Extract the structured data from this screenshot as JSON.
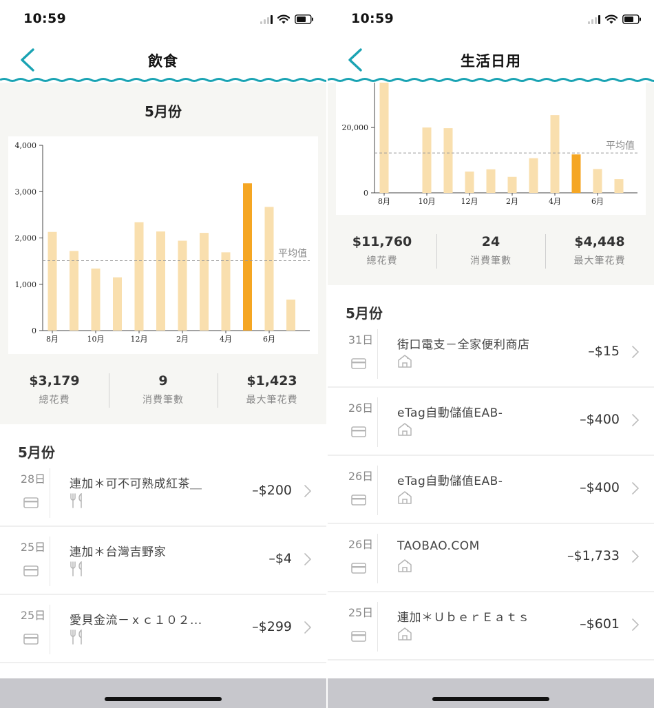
{
  "status_bar": {
    "time": "10:59"
  },
  "left": {
    "title": "飲食",
    "summary_heading": "5月份",
    "stats": [
      {
        "value": "$3,179",
        "label": "總花費"
      },
      {
        "value": "9",
        "label": "消費筆數"
      },
      {
        "value": "$1,423",
        "label": "最大筆花費"
      }
    ],
    "list_heading": "5月份",
    "transactions": [
      {
        "day": "28日",
        "name": "連加＊可不可熟成紅茶＿",
        "amount": "–$200",
        "category_icon": "utensils-icon"
      },
      {
        "day": "25日",
        "name": "連加＊台灣吉野家",
        "amount": "–$4",
        "category_icon": "utensils-icon"
      },
      {
        "day": "25日",
        "name": "愛貝金流－ｘｃ１０２...",
        "amount": "–$299",
        "category_icon": "utensils-icon"
      }
    ]
  },
  "right": {
    "title": "生活日用",
    "stats": [
      {
        "value": "$11,760",
        "label": "總花費"
      },
      {
        "value": "24",
        "label": "消費筆數"
      },
      {
        "value": "$4,448",
        "label": "最大筆花費"
      }
    ],
    "list_heading": "5月份",
    "transactions": [
      {
        "day": "31日",
        "name": "街口電支－全家便利商店",
        "amount": "–$15",
        "category_icon": "house-icon"
      },
      {
        "day": "26日",
        "name": "eTag自動儲值EAB-",
        "amount": "–$400",
        "category_icon": "house-icon"
      },
      {
        "day": "26日",
        "name": "eTag自動儲值EAB-",
        "amount": "–$400",
        "category_icon": "house-icon"
      },
      {
        "day": "26日",
        "name": "TAOBAO.COM",
        "amount": "–$1,733",
        "category_icon": "house-icon"
      },
      {
        "day": "25日",
        "name": "連加＊ＵｂｅｒＥａｔｓ",
        "amount": "–$601",
        "category_icon": "house-icon"
      }
    ]
  },
  "colors": {
    "accent_teal": "#1aa3b3",
    "bar_light": "#f9dfae",
    "bar_highlight": "#f5a623",
    "panel_bg": "#f6f6f3"
  },
  "chart_data": [
    {
      "type": "bar",
      "categories": [
        "8月",
        "9月",
        "10月",
        "11月",
        "12月",
        "1月",
        "2月",
        "3月",
        "4月",
        "5月",
        "6月",
        "7月"
      ],
      "x_tick_labels": [
        "8月",
        "",
        "10月",
        "",
        "12月",
        "",
        "2月",
        "",
        "4月",
        "",
        "6月",
        ""
      ],
      "values": [
        2130,
        1720,
        1340,
        1150,
        2340,
        2140,
        1940,
        2110,
        1690,
        3179,
        2670,
        670
      ],
      "highlight_index": 9,
      "average_line": 1510,
      "average_label": "平均值",
      "ylim": [
        0,
        4000
      ],
      "yticks": [
        0,
        1000,
        2000,
        3000,
        4000
      ],
      "ytick_labels": [
        "0",
        "1,000",
        "2,000",
        "3,000",
        "4,000"
      ]
    },
    {
      "type": "bar",
      "categories": [
        "8月",
        "9月",
        "10月",
        "11月",
        "12月",
        "1月",
        "2月",
        "3月",
        "4月",
        "5月",
        "6月",
        "7月"
      ],
      "x_tick_labels": [
        "8月",
        "",
        "10月",
        "",
        "12月",
        "",
        "2月",
        "",
        "4月",
        "",
        "6月",
        ""
      ],
      "values": [
        36000,
        0,
        20000,
        19800,
        6500,
        7200,
        4900,
        10600,
        23800,
        11760,
        7300,
        4200
      ],
      "highlight_index": 9,
      "average_line": 12200,
      "average_label": "平均值",
      "ylim": [
        0,
        35000
      ],
      "yticks": [
        0,
        20000
      ],
      "ytick_labels": [
        "0",
        "20,000"
      ]
    }
  ]
}
